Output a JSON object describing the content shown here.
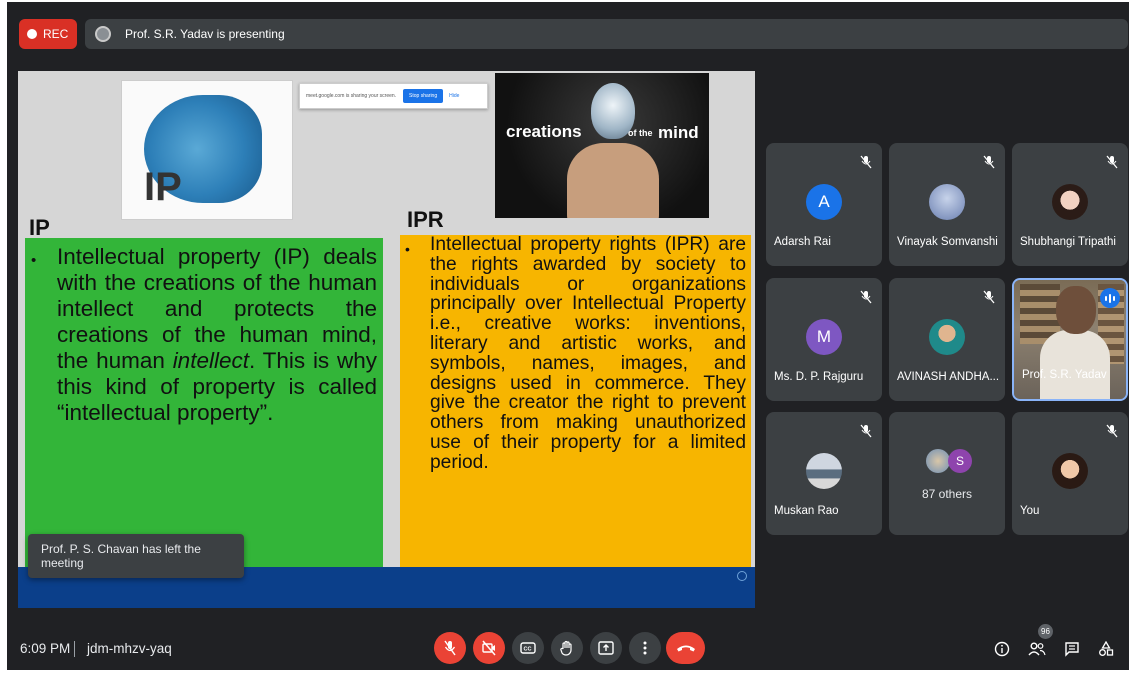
{
  "rec": {
    "label": "REC"
  },
  "banner": {
    "text": "Prof. S.R. Yadav is presenting"
  },
  "slide": {
    "share_bar": {
      "text": "meet.google.com is sharing your screen.",
      "stop": "Stop sharing",
      "hide": "Hide"
    },
    "ip_image_text": "IP",
    "bulb_words": [
      "creations",
      "of the",
      "mind"
    ],
    "ip_heading": "IP",
    "ipr_heading": "IPR",
    "ip_bullet": "•",
    "ipr_bullet": "•",
    "ip_text_a": "Intellectual property (IP) deals with the creations of the human intellect and protects the creations of the human mind, the human ",
    "ip_text_em": "intellect",
    "ip_text_b": ". This is why this kind of property is called “intellectual property”.",
    "ipr_text": "Intellectual property rights (IPR) are the rights awarded by society to individuals or organizations principally over Intellectual Property i.e., creative works: inventions, literary and artistic works, and symbols, names, images, and designs used in commerce. They give the creator the right to prevent others from making unauthorized use of their property for a limited period."
  },
  "toast": "Prof. P. S. Chavan has left the meeting",
  "participants": [
    {
      "name": "Adarsh Rai",
      "initial": "A",
      "avatar_color": "#1a73e8"
    },
    {
      "name": "Vinayak Somvanshi"
    },
    {
      "name": "Shubhangi Tripathi"
    },
    {
      "name": "Ms. D. P. Rajguru",
      "initial": "M",
      "avatar_color": "#7e57c2"
    },
    {
      "name": "AVINASH ANDHA..."
    },
    {
      "name": "Prof. S.R. Yadav"
    },
    {
      "name": "Muskan Rao"
    },
    {
      "name": "87 others",
      "initial": "S",
      "avatar_color": "#8e44ad"
    },
    {
      "name": "You"
    }
  ],
  "bottom": {
    "time": "6:09 PM",
    "meeting_code": "jdm-mhzv-yaq",
    "people_count": "96"
  }
}
